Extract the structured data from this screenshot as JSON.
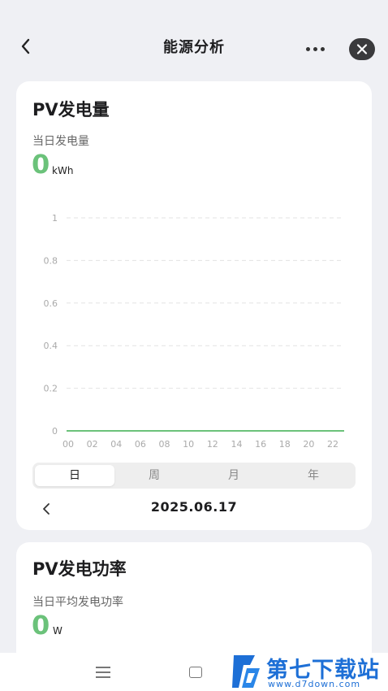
{
  "header": {
    "title": "能源分析"
  },
  "pv_energy": {
    "title": "PV发电量",
    "daily_label": "当日发电量",
    "value": "0",
    "unit": "kWh",
    "tabs": [
      "日",
      "周",
      "月",
      "年"
    ],
    "active_tab": "日",
    "date": "2025.06.17"
  },
  "pv_power": {
    "title": "PV发电功率",
    "avg_label": "当日平均发电功率",
    "value": "0",
    "unit": "W"
  },
  "watermark": {
    "text": "第七下载站",
    "url": "www.d7down.com"
  },
  "colors": {
    "accent": "#6bc27a",
    "grid": "#e3e3e3",
    "watermark": "#1d6fd6"
  },
  "chart_data": {
    "type": "line",
    "x": [
      "00",
      "02",
      "04",
      "06",
      "08",
      "10",
      "12",
      "14",
      "16",
      "18",
      "20",
      "22"
    ],
    "series": [
      {
        "values": [
          0,
          0,
          0,
          0,
          0,
          0,
          0,
          0,
          0,
          0,
          0,
          0
        ]
      }
    ],
    "y_ticks": [
      "1",
      "0.8",
      "0.6",
      "0.4",
      "0.2",
      "0"
    ],
    "ylim": [
      0,
      1
    ],
    "grid": true,
    "title": "",
    "xlabel": "",
    "ylabel": ""
  }
}
